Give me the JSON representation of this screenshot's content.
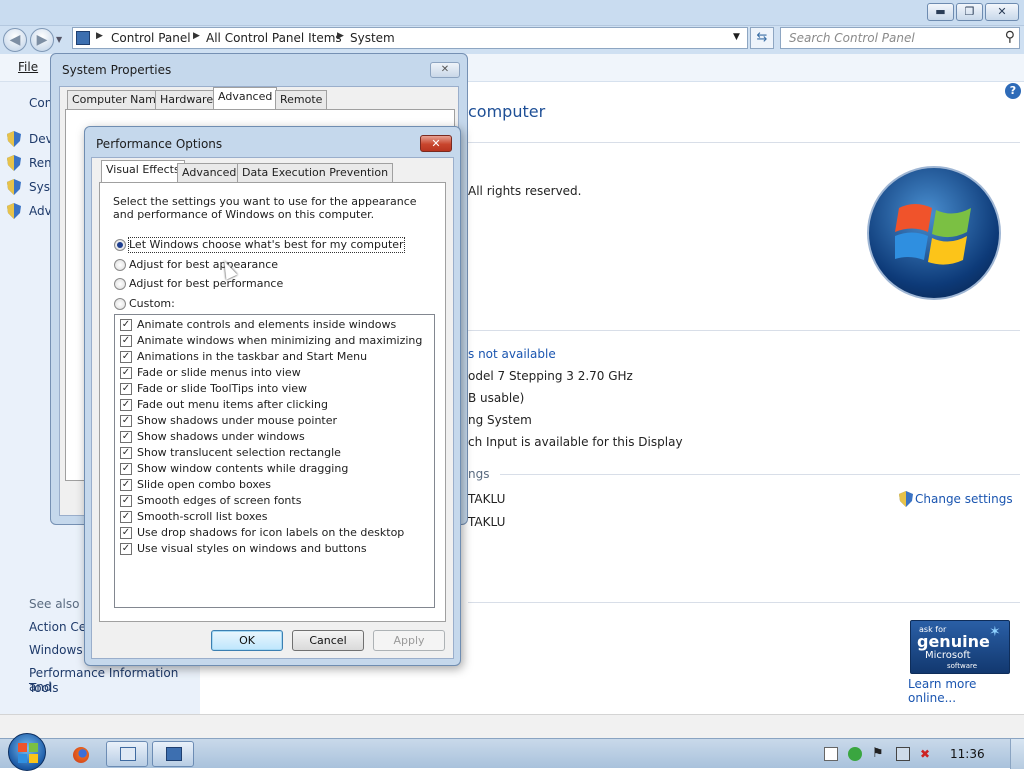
{
  "explorer": {
    "breadcrumb": [
      "Control Panel",
      "All Control Panel Items",
      "System"
    ],
    "search_placeholder": "Search Control Panel",
    "menu": {
      "file": "File"
    },
    "left_pane": {
      "control_panel_home": "Cont",
      "items": [
        "Devi",
        "Rem",
        "Syst",
        "Adv"
      ],
      "see_also_heading": "See also",
      "see_also": [
        "Action Cen",
        "Windows U",
        "Performance Information and",
        "Tools"
      ]
    },
    "right_pane": {
      "heading_fragment": "computer",
      "copyright_fragment": "All rights reserved.",
      "rating_link": "s not available",
      "processor_fragment": "odel 7 Stepping 3   2.70 GHz",
      "ram_fragment": "B usable)",
      "systype_fragment": "ng System",
      "pen_fragment": "ch Input is available for this Display",
      "settings_heading_fragment": "ngs",
      "computer_name_fragment": "TAKLU",
      "full_name_fragment": "TAKLU",
      "change_settings": "Change settings",
      "genuine": {
        "ask_for": "ask for",
        "genuine": "genuine",
        "microsoft": "Microsoft",
        "software": "software"
      },
      "learn_more": "Learn more online..."
    }
  },
  "system_properties": {
    "title": "System Properties",
    "tabs": [
      "Computer Name",
      "Hardware",
      "Advanced",
      "Remote"
    ],
    "selected_tab": "Advanced"
  },
  "performance_options": {
    "title": "Performance Options",
    "tabs": [
      "Visual Effects",
      "Advanced",
      "Data Execution Prevention"
    ],
    "selected_tab": "Visual Effects",
    "description": "Select the settings you want to use for the appearance and performance of Windows on this computer.",
    "options": [
      {
        "label": "Let Windows choose what's best for my computer",
        "selected": true
      },
      {
        "label": "Adjust for best appearance",
        "selected": false
      },
      {
        "label": "Adjust for best performance",
        "selected": false
      },
      {
        "label": "Custom:",
        "selected": false
      }
    ],
    "effects": [
      "Animate controls and elements inside windows",
      "Animate windows when minimizing and maximizing",
      "Animations in the taskbar and Start Menu",
      "Fade or slide menus into view",
      "Fade or slide ToolTips into view",
      "Fade out menu items after clicking",
      "Show shadows under mouse pointer",
      "Show shadows under windows",
      "Show translucent selection rectangle",
      "Show window contents while dragging",
      "Slide open combo boxes",
      "Smooth edges of screen fonts",
      "Smooth-scroll list boxes",
      "Use drop shadows for icon labels on the desktop",
      "Use visual styles on windows and buttons"
    ],
    "buttons": {
      "ok": "OK",
      "cancel": "Cancel",
      "apply": "Apply"
    }
  },
  "taskbar": {
    "clock": "11:36"
  }
}
